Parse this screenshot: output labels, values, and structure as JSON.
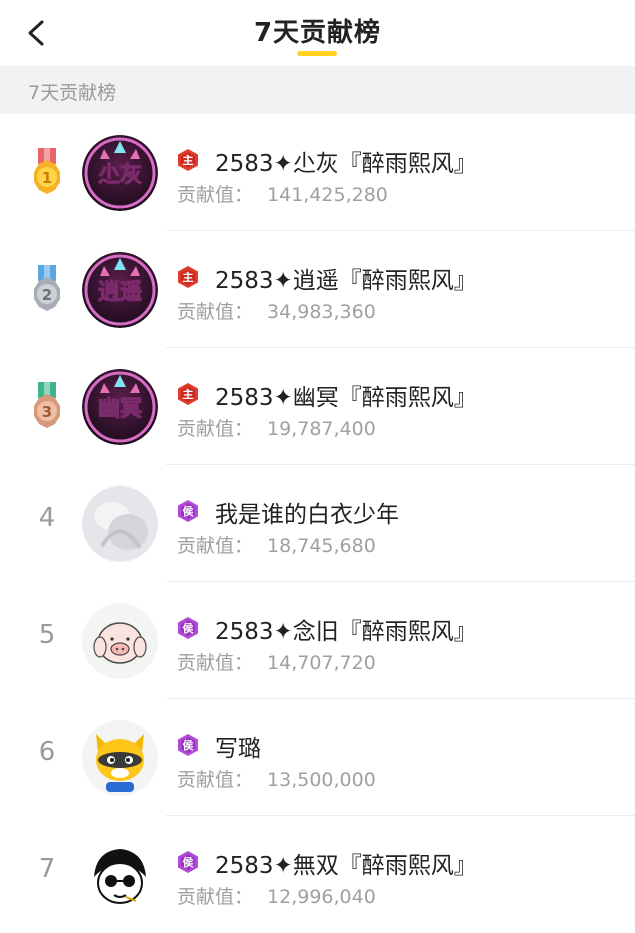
{
  "header": {
    "title": "7天贡献榜",
    "accent_color": "#ffd21e"
  },
  "section": {
    "label": "7天贡献榜"
  },
  "score_label": "贡献值：",
  "rows": [
    {
      "rank": "1",
      "medal": "gold",
      "avatar_text": "尐灰",
      "badge": "主",
      "name": "2583✦尐灰『醉雨熙风』",
      "score": "141,425,280"
    },
    {
      "rank": "2",
      "medal": "silver",
      "avatar_text": "逍遥",
      "badge": "主",
      "name": "2583✦逍遥『醉雨熙风』",
      "score": "34,983,360"
    },
    {
      "rank": "3",
      "medal": "bronze",
      "avatar_text": "幽冥",
      "badge": "主",
      "name": "2583✦幽冥『醉雨熙风』",
      "score": "19,787,400"
    },
    {
      "rank": "4",
      "medal": "",
      "avatar_text": "",
      "badge": "侯",
      "name": "我是谁的白衣少年",
      "score": "18,745,680"
    },
    {
      "rank": "5",
      "medal": "",
      "avatar_text": "",
      "badge": "侯",
      "name": "2583✦念旧『醉雨熙风』",
      "score": "14,707,720"
    },
    {
      "rank": "6",
      "medal": "",
      "avatar_text": "",
      "badge": "侯",
      "name": "写璐",
      "score": "13,500,000"
    },
    {
      "rank": "7",
      "medal": "",
      "avatar_text": "",
      "badge": "侯",
      "name": "2583✦無双『醉雨熙风』",
      "score": "12,996,040"
    }
  ]
}
